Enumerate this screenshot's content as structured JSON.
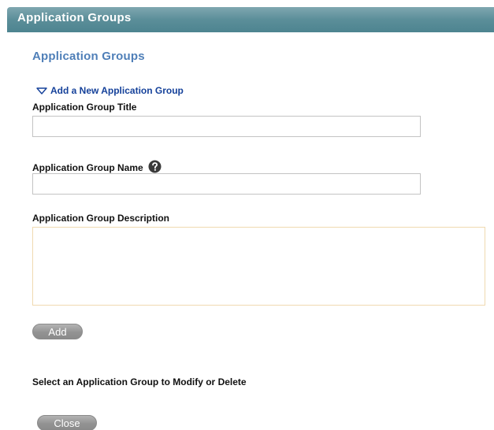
{
  "header": {
    "title": "Application Groups"
  },
  "main": {
    "section_heading": "Application Groups",
    "add_toggle_label": "Add a New Application Group",
    "fields": {
      "title": {
        "label": "Application Group Title",
        "value": ""
      },
      "name": {
        "label": "Application Group Name",
        "value": "",
        "help_icon": "question-circle-icon"
      },
      "description": {
        "label": "Application Group Description",
        "value": ""
      }
    },
    "add_button_label": "Add",
    "select_prompt": "Select an Application Group to Modify or Delete",
    "close_button_label": "Close"
  },
  "colors": {
    "header_bar": "#5b8e99",
    "heading_text": "#4f7fb8",
    "link_text": "#15419a",
    "button_gray": "#939393",
    "textarea_border": "#f0d9b0"
  }
}
